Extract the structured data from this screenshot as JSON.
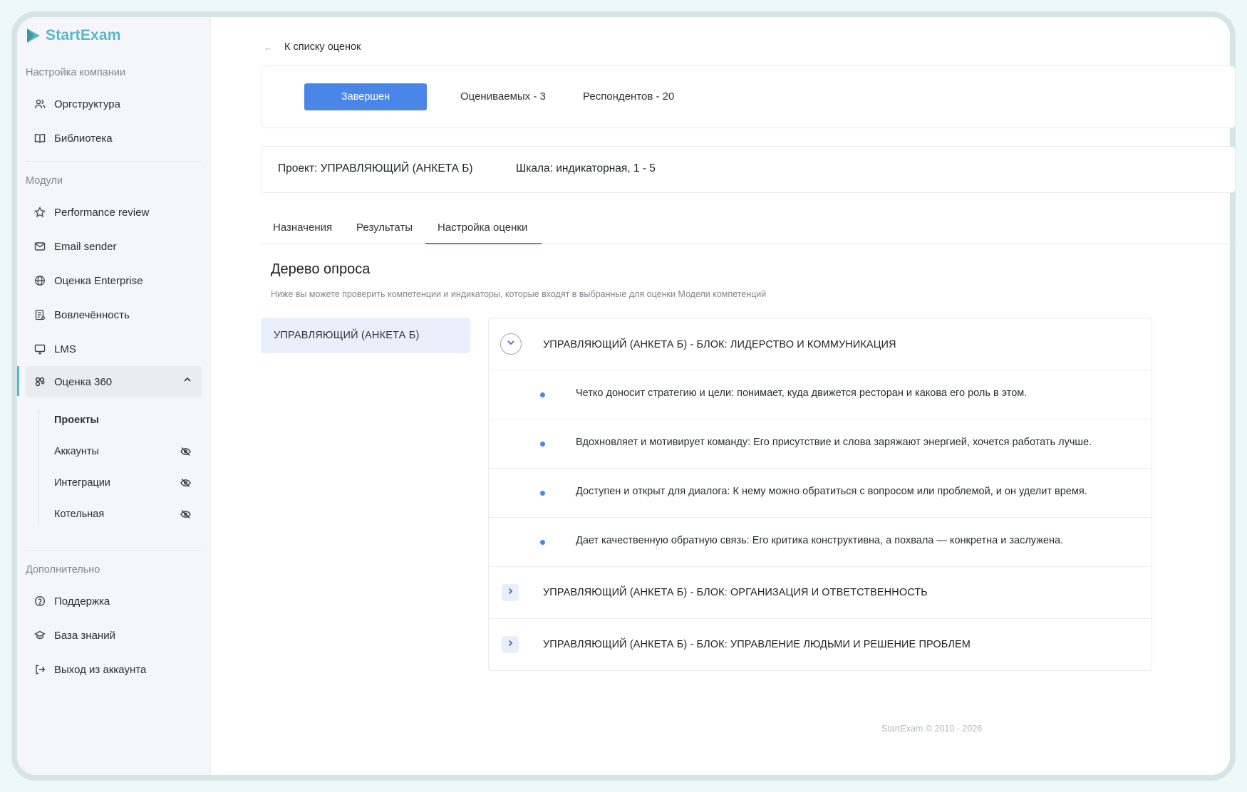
{
  "brand": {
    "name": "StartExam",
    "color": "#5ab5c8"
  },
  "sidebar": {
    "company_section": "Настройка компании",
    "company_items": [
      {
        "label": "Оргструктура",
        "icon": "people-icon"
      },
      {
        "label": "Библиотека",
        "icon": "book-icon"
      }
    ],
    "modules_section": "Модули",
    "module_items": [
      {
        "label": "Performance review",
        "icon": "star-icon"
      },
      {
        "label": "Email sender",
        "icon": "mail-icon"
      },
      {
        "label": "Оценка Enterprise",
        "icon": "globe-icon"
      },
      {
        "label": "Вовлечённость",
        "icon": "survey-icon"
      },
      {
        "label": "LMS",
        "icon": "monitor-icon"
      },
      {
        "label": "Оценка 360",
        "icon": "360-icon",
        "active": true,
        "expanded": true
      }
    ],
    "sub_items": [
      {
        "label": "Проекты",
        "hidden": false
      },
      {
        "label": "Аккаунты",
        "hidden": true
      },
      {
        "label": "Интеграции",
        "hidden": true
      },
      {
        "label": "Котельная",
        "hidden": true
      }
    ],
    "extra_section": "Дополнительно",
    "extra_items": [
      {
        "label": "Поддержка",
        "icon": "help-icon"
      },
      {
        "label": "База знаний",
        "icon": "graduation-cap-icon"
      },
      {
        "label": "Выход из аккаунта",
        "icon": "logout-icon"
      }
    ]
  },
  "main": {
    "back_label": "К списку оценок",
    "status_label": "Завершен",
    "assessed": "Оцениваемых - 3",
    "respondents": "Респондентов - 20",
    "project": "Проект: УПРАВЛЯЮЩИЙ (АНКЕТА Б)",
    "scale": "Шкала: индикаторная, 1 - 5",
    "tabs": [
      "Назначения",
      "Результаты",
      "Настройка оценки"
    ],
    "active_tab": "Настройка оценки",
    "tree_title": "Дерево опроса",
    "tree_subtitle": "Ниже вы можете проверить компетенции и индикаторы, которые входят в выбранные для оценки Модели компетенций",
    "model_name": "УПРАВЛЯЮЩИЙ (АНКЕТА Б)",
    "blocks": [
      {
        "title": "УПРАВЛЯЮЩИЙ (АНКЕТА Б) - БЛОК: ЛИДЕРСТВО И КОММУНИКАЦИЯ",
        "expanded": true,
        "indicators": [
          "Четко доносит стратегию и цели: понимает, куда движется ресторан и какова его роль в этом.",
          "Вдохновляет и мотивирует команду: Его присутствие и слова заряжают энергией, хочется работать лучше.",
          "Доступен и открыт для диалога: К нему можно обратиться с вопросом или проблемой, и он уделит время.",
          "Дает качественную обратную связь: Его критика конструктивна, а похвала — конкретна и заслужена."
        ]
      },
      {
        "title": "УПРАВЛЯЮЩИЙ (АНКЕТА Б) - БЛОК: ОРГАНИЗАЦИЯ И ОТВЕТСТВЕННОСТЬ",
        "expanded": false
      },
      {
        "title": "УПРАВЛЯЮЩИЙ (АНКЕТА Б) - БЛОК: УПРАВЛЕНИЕ ЛЮДЬМИ И РЕШЕНИЕ ПРОБЛЕМ",
        "expanded": false
      }
    ],
    "accent_color": "#4a86e8"
  },
  "footer": "StartExam © 2010 - 2026"
}
